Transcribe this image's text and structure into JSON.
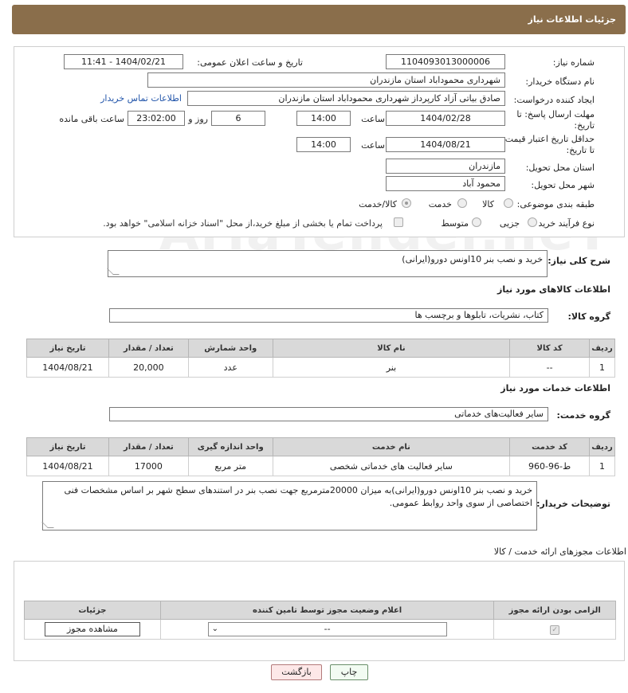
{
  "header": {
    "title": "جزئیات اطلاعات نیاز"
  },
  "form": {
    "need_number": {
      "label": "شماره نیاز:",
      "value": "1104093013000006"
    },
    "announce_datetime": {
      "label": "تاریخ و ساعت اعلان عمومی:",
      "value": "1404/02/21 - 11:41"
    },
    "buyer_org": {
      "label": "نام دستگاه خریدار:",
      "value": "شهرداری محموداباد استان مازندران"
    },
    "requester": {
      "label": "ایجاد کننده درخواست:",
      "value": "صادق بیاتی آزاد کارپرداز شهرداری محموداباد استان مازندران",
      "link": "اطلاعات تماس خریدار"
    },
    "reply_deadline": {
      "label_line1": "مهلت ارسال پاسخ: تا",
      "label_line2": "تاریخ:",
      "date": "1404/02/28",
      "time_label": "ساعت",
      "time": "14:00",
      "days": "6",
      "days_label": "روز و",
      "remaining": "23:02:00",
      "remaining_label": "ساعت باقی مانده"
    },
    "price_validity": {
      "label_line1": "حداقل تاریخ اعتبار قیمت:",
      "label_line2": "تا تاریخ:",
      "date": "1404/08/21",
      "time_label": "ساعت",
      "time": "14:00"
    },
    "delivery_province": {
      "label": "استان محل تحویل:",
      "value": "مازندران"
    },
    "delivery_city": {
      "label": "شهر محل تحویل:",
      "value": "محمود آباد"
    },
    "category": {
      "label": "طبقه بندی موضوعی:",
      "options": [
        "کالا",
        "خدمت",
        "کالا/خدمت"
      ],
      "selected": "کالا/خدمت"
    },
    "purchase_type": {
      "label": "نوع فرآیند خرید :",
      "options": [
        "جزیی",
        "متوسط"
      ],
      "selected": "",
      "treasury_note": "پرداخت تمام یا بخشی از مبلغ خرید،از محل \"اسناد خزانه اسلامی\" خواهد بود."
    }
  },
  "description": {
    "label": "شرح کلی نیاز:",
    "value": "خرید و نصب بنر 10اونس دورو(ایرانی)"
  },
  "goods": {
    "section_title": "اطلاعات کالاهای مورد نیاز",
    "group_label": "گروه کالا:",
    "group_value": "کتاب، نشریات، تابلوها و برچسب ها",
    "columns": [
      "ردیف",
      "کد کالا",
      "نام کالا",
      "واحد شمارش",
      "تعداد / مقدار",
      "تاریخ نیاز"
    ],
    "rows": [
      {
        "row": "1",
        "code": "--",
        "name": "بنر",
        "unit": "عدد",
        "qty": "20,000",
        "date": "1404/08/21"
      }
    ]
  },
  "services": {
    "section_title": "اطلاعات خدمات مورد نیاز",
    "group_label": "گروه خدمت:",
    "group_value": "سایر فعالیت‌های خدماتی",
    "columns": [
      "ردیف",
      "کد خدمت",
      "نام خدمت",
      "واحد اندازه گیری",
      "تعداد / مقدار",
      "تاریخ نیاز"
    ],
    "rows": [
      {
        "row": "1",
        "code": "ط-96-960",
        "name": "سایر فعالیت های خدماتی شخصی",
        "unit": "متر مربع",
        "qty": "17000",
        "date": "1404/08/21"
      }
    ]
  },
  "buyer_notes": {
    "label": "توضیحات خریدار:",
    "value": "خرید و نصب بنر 10اونس دورو(ایرانی)به میزان 20000مترمربع جهت نصب بنر در استندهای سطح شهر بر اساس مشخصات فنی اختصاصی از سوی واحد روابط عمومی."
  },
  "permits": {
    "section_title": "اطلاعات مجوزهای ارائه خدمت / کالا",
    "columns": [
      "الزامی بودن ارائه مجوز",
      "اعلام وضعیت مجوز توسط تامین کننده",
      "جزئیات"
    ],
    "select_value": "--",
    "view_button": "مشاهده مجوز"
  },
  "footer": {
    "print_button": "چاپ",
    "back_button": "بازگشت"
  },
  "watermark": "AriaTender.neT"
}
